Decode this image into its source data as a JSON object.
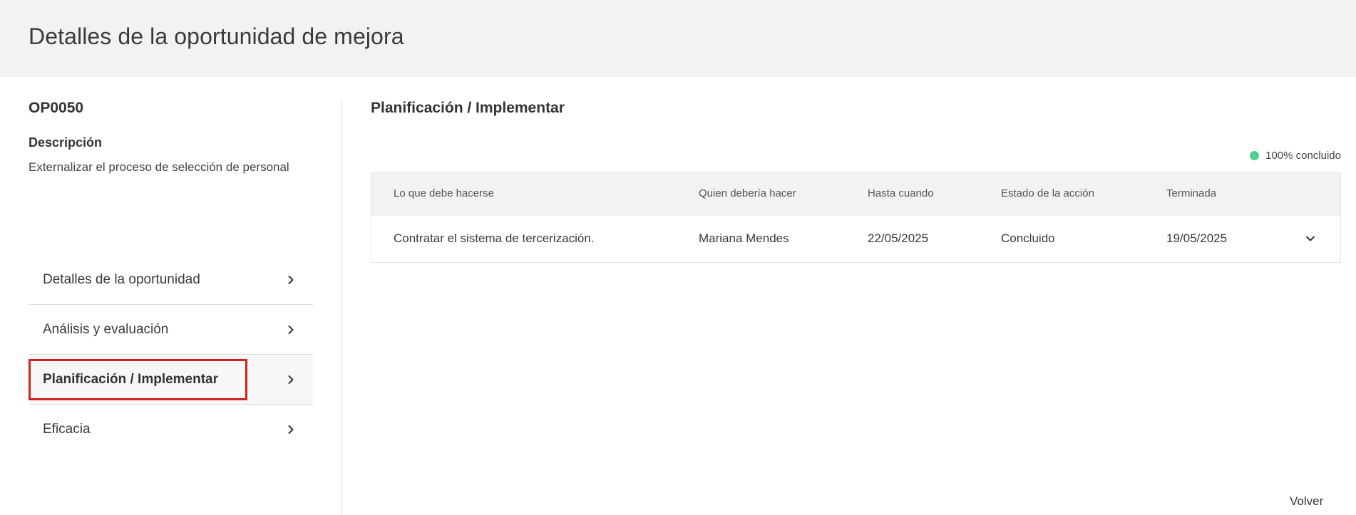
{
  "header": {
    "title": "Detalles de la oportunidad de mejora"
  },
  "left": {
    "code": "OP0050",
    "description_title": "Descripción",
    "description_text": "Externalizar el proceso de selección de personal",
    "nav": [
      {
        "label": "Detalles de la oportunidad",
        "active": false
      },
      {
        "label": "Análisis y evaluación",
        "active": false
      },
      {
        "label": "Planificación / Implementar",
        "active": true
      },
      {
        "label": "Eficacia",
        "active": false
      }
    ]
  },
  "main": {
    "section_title": "Planificación / Implementar",
    "progress_label": "100% concluido",
    "progress_color": "#4fd18b",
    "table": {
      "columns": [
        "Lo que debe hacerse",
        "Quien debería hacer",
        "Hasta cuando",
        "Estado de la acción",
        "Terminada"
      ],
      "rows": [
        [
          "Contratar el sistema de tercerización.",
          "Mariana Mendes",
          "22/05/2025",
          "Concluido",
          "19/05/2025"
        ]
      ]
    }
  },
  "footer": {
    "back_label": "Volver"
  },
  "colors": {
    "header_bg": "#f2f2f2",
    "highlight": "#d32020",
    "success": "#4fd18b"
  },
  "icons": {
    "nav_chevron": "chevron-right-icon",
    "row_expand": "chevron-down-icon",
    "status": "status-dot-icon"
  }
}
